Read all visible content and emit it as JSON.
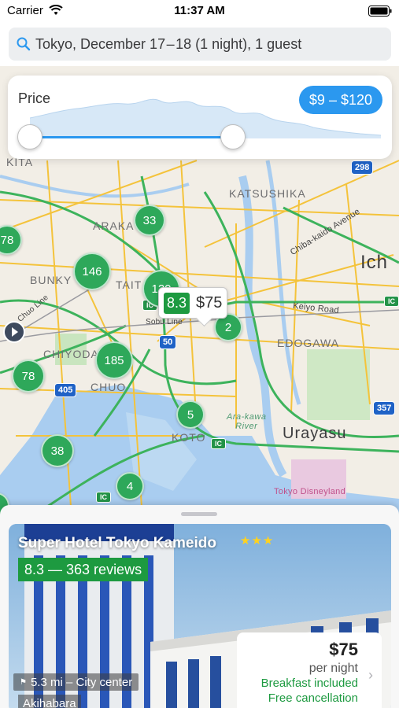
{
  "status_bar": {
    "carrier": "Carrier",
    "time": "11:37 AM"
  },
  "search": {
    "text": "Tokyo, December 17 – 18 (1 night), 1 guest"
  },
  "price_filter": {
    "label": "Price",
    "range": "$9 – $120"
  },
  "map": {
    "place_labels": {
      "kita": "KITA",
      "arakawa": "ARAKA",
      "bunkyo": "BUNKY",
      "taito": "TAIT",
      "katsushika": "KATSUSHIKA",
      "edogawa": "EDOGAWA",
      "chiyoda": "CHIYODA",
      "chuo": "CHUO",
      "koto": "KOTO",
      "urayasu": "Urayasu",
      "ichikawa": "Ich",
      "disneyland": "Tokyo Disneyland",
      "arakawa_river": "Ara-kawa\nRiver",
      "keiyo_road": "Keiyo Road",
      "chiba_kaido": "Chiba-kaido Avenue",
      "chuo_line": "Chuo Line",
      "sobu_line": "Sobu Line"
    },
    "clusters": [
      "78",
      "146",
      "33",
      "120",
      "2",
      "185",
      "78",
      "5",
      "38",
      "4",
      "2"
    ],
    "route_shields": {
      "r298": "298",
      "r405": "405",
      "r50": "50",
      "r357": "357",
      "ic1": "IC",
      "ic2": "IC",
      "ic3": "IC",
      "ic4": "IC"
    },
    "selected_pin": {
      "rating": "8.3",
      "price": "$75"
    }
  },
  "hotel": {
    "name": "Super Hotel Tokyo Kameido",
    "stars": "★★★",
    "rating_text": "8.3 — 363 reviews",
    "distance": "5.3 mi – City center",
    "area": "Akihabara",
    "price": "$75",
    "per_night": "per night",
    "breakfast": "Breakfast included",
    "cancellation": "Free cancellation"
  },
  "colors": {
    "accent": "#2b98ef",
    "rating_green": "#1d9a40",
    "cluster_green": "#2ea85a"
  }
}
